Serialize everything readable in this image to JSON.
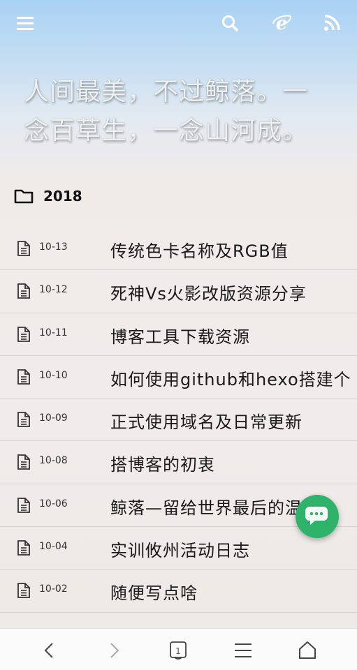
{
  "header": {
    "icons": [
      "menu-icon",
      "search-icon",
      "ie-icon",
      "rss-icon"
    ]
  },
  "hero": {
    "line1": "人间最美，不过鲸落。一",
    "line2": "念百草生，一念山河成。"
  },
  "archive": {
    "year": "2018",
    "posts": [
      {
        "date": "10-13",
        "title": "传统色卡名称及RGB值"
      },
      {
        "date": "10-12",
        "title": "死神Vs火影改版资源分享"
      },
      {
        "date": "10-11",
        "title": "博客工具下载资源"
      },
      {
        "date": "10-10",
        "title": "如何使用github和hexo搭建个"
      },
      {
        "date": "10-09",
        "title": "正式使用域名及日常更新"
      },
      {
        "date": "10-08",
        "title": "搭博客的初衷"
      },
      {
        "date": "10-06",
        "title": "鲸落—留给世界最后的温柔"
      },
      {
        "date": "10-04",
        "title": "实训攸州活动日志"
      },
      {
        "date": "10-02",
        "title": "随便写点啥"
      }
    ]
  },
  "bottom_nav": {
    "tab_count": "1",
    "icons": [
      "back-icon",
      "forward-icon",
      "tabs-icon",
      "menu-icon",
      "home-icon"
    ]
  },
  "colors": {
    "fab": "#2fb36a"
  }
}
